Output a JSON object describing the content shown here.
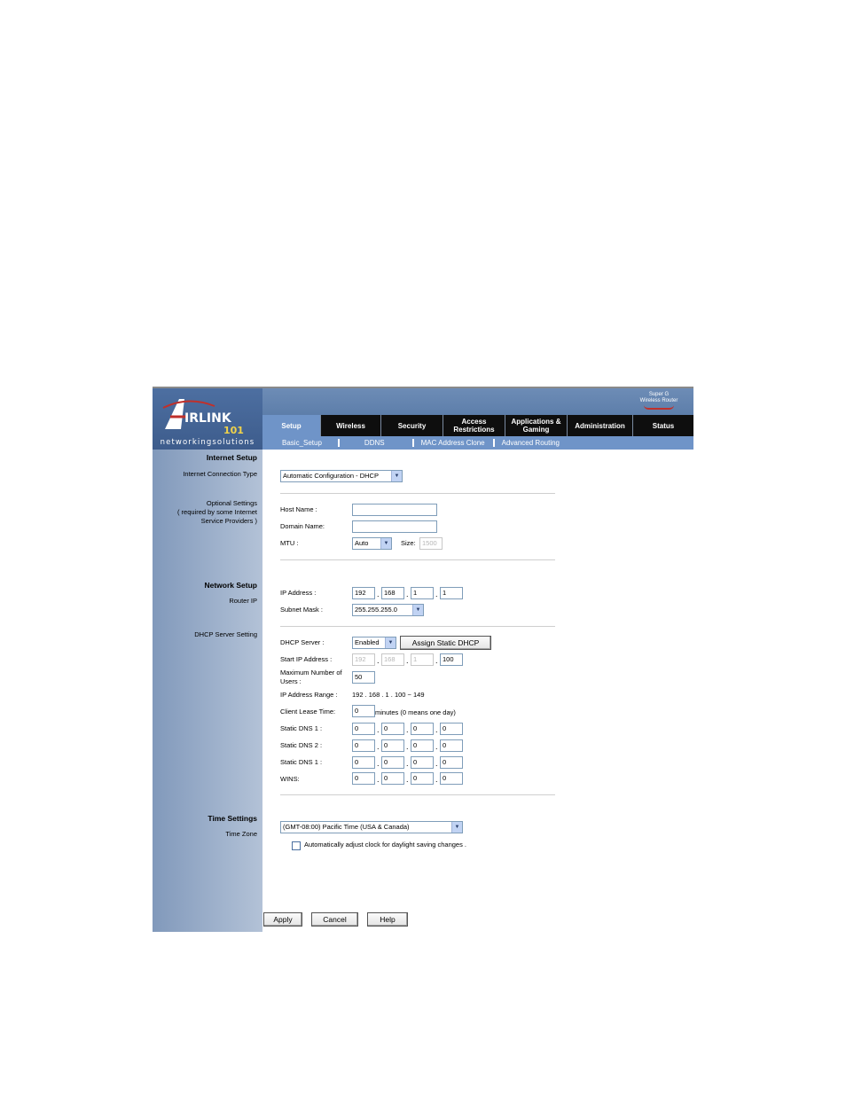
{
  "brand": {
    "logo_text": "AirLink 101",
    "tagline": "networkingsolutions",
    "product_line1": "Super G",
    "product_line2": "Wireless Router"
  },
  "tabs": [
    "Setup",
    "Wireless",
    "Security",
    "Access Restrictions",
    "Applications & Gaming",
    "Administration",
    "Status"
  ],
  "subnav": [
    "Basic_Setup",
    "DDNS",
    "MAC Address Clone",
    "Advanced Routing"
  ],
  "sidebar": {
    "internet_setup": "Internet Setup",
    "connection_type": "Internet Connection Type",
    "optional_settings": "Optional Settings",
    "optional_note": "( required by some Internet Service Providers )",
    "network_setup": "Network Setup",
    "router_ip": "Router IP",
    "dhcp_server_setting": "DHCP Server Setting",
    "time_settings": "Time Settings",
    "time_zone": "Time Zone"
  },
  "internet": {
    "connection_type_value": "Automatic Configuration - DHCP",
    "host_name_label": "Host Name :",
    "host_name_value": "",
    "domain_name_label": "Domain Name:",
    "domain_name_value": "",
    "mtu_label": "MTU :",
    "mtu_value": "Auto",
    "size_label": "Size:",
    "size_value": "1500"
  },
  "network": {
    "ip_label": "IP Address :",
    "ip": [
      "192",
      "168",
      "1",
      "1"
    ],
    "subnet_label": "Subnet Mask :",
    "subnet_value": "255.255.255.0"
  },
  "dhcp": {
    "server_label": "DHCP Server :",
    "server_value": "Enabled",
    "assign_static_button": "Assign Static DHCP",
    "start_ip_label": "Start IP Address :",
    "start_ip": [
      "192",
      "168",
      "1",
      "100"
    ],
    "max_users_label": "Maximum Number of Users :",
    "max_users_value": "50",
    "range_label": "IP Address Range :",
    "range_value": "192 . 168 . 1 . 100 ~ 149",
    "lease_label": "Client Lease Time:",
    "lease_value": "0",
    "lease_note": "minutes (0 means one day)",
    "dns1_label": "Static DNS 1 :",
    "dns1": [
      "0",
      "0",
      "0",
      "0"
    ],
    "dns2_label": "Static DNS 2 :",
    "dns2": [
      "0",
      "0",
      "0",
      "0"
    ],
    "dns3_label": "Static DNS 1 :",
    "dns3": [
      "0",
      "0",
      "0",
      "0"
    ],
    "wins_label": "WINS:",
    "wins": [
      "0",
      "0",
      "0",
      "0"
    ]
  },
  "time": {
    "zone_value": "(GMT-08:00) Pacific Time (USA & Canada)",
    "dst_label": "Automatically adjust clock for daylight saving changes .",
    "dst_checked": false
  },
  "buttons": {
    "apply": "Apply",
    "cancel": "Cancel",
    "help": "Help"
  }
}
